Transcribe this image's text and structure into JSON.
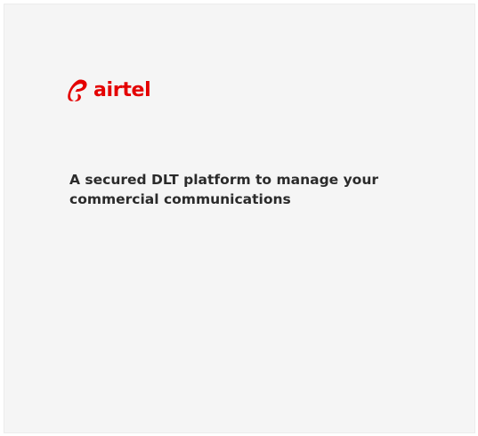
{
  "brand": {
    "name": "airtel",
    "logo_icon": "airtel-swirl-icon",
    "accent_color": "#e40000"
  },
  "hero": {
    "tagline": "A secured DLT platform to manage your commercial communications"
  }
}
